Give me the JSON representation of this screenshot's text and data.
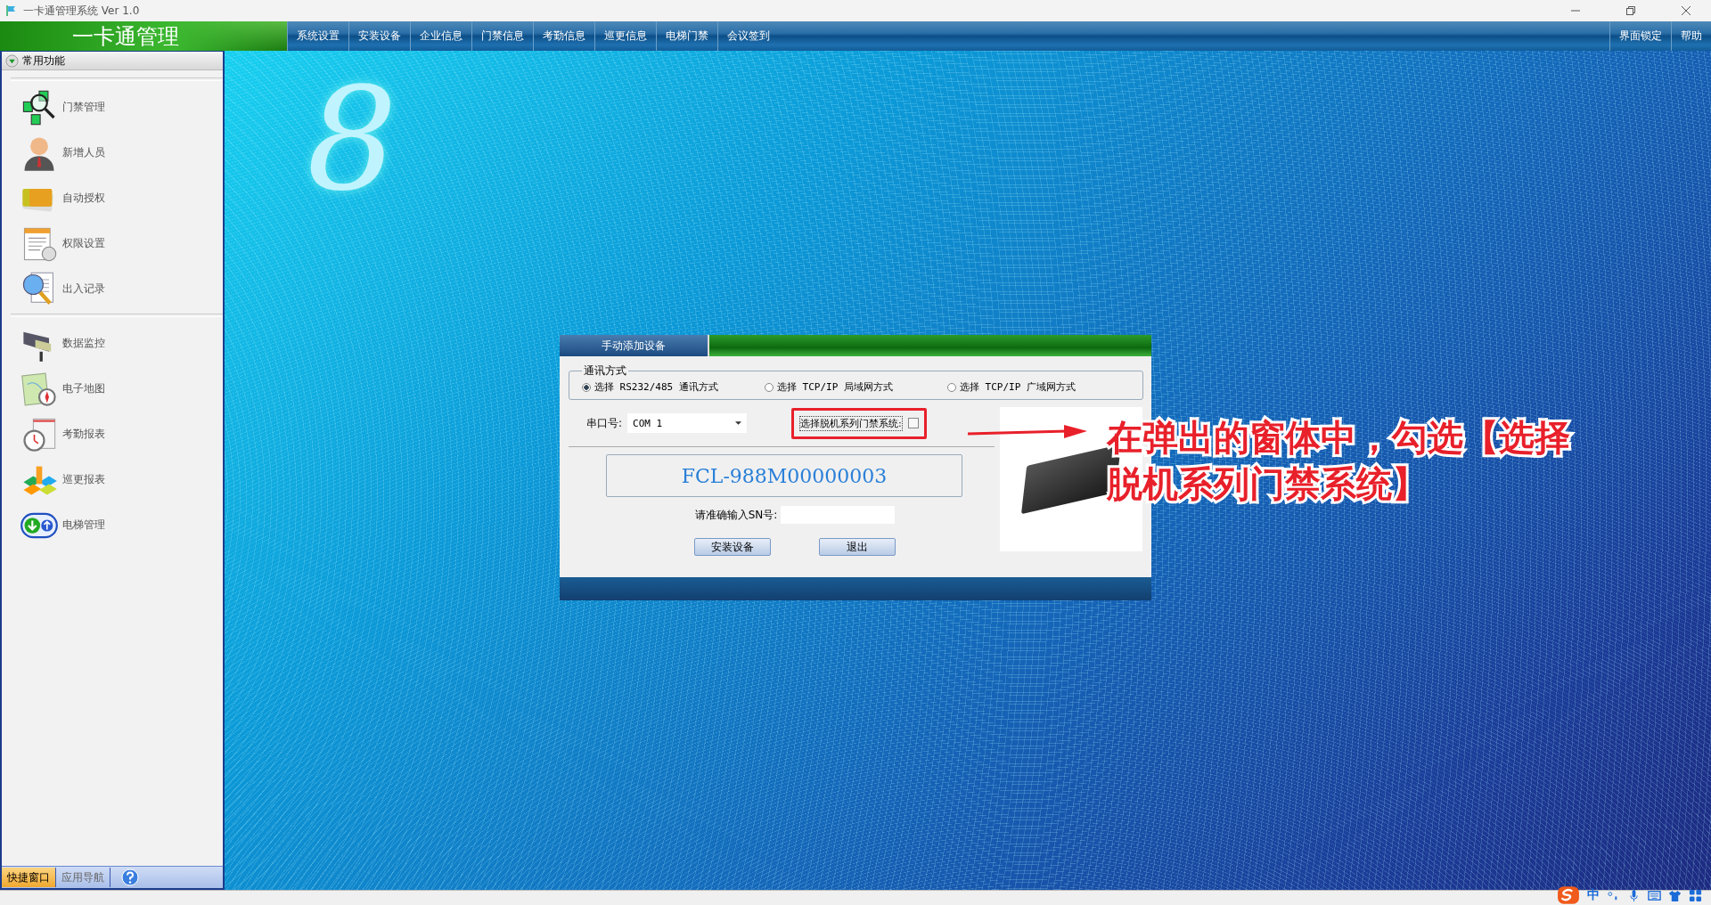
{
  "window": {
    "title": "一卡通管理系统 Ver 1.0"
  },
  "app_title": "一卡通管理",
  "menu": [
    {
      "label": "系统设置"
    },
    {
      "label": "安装设备"
    },
    {
      "label": "企业信息"
    },
    {
      "label": "门禁信息"
    },
    {
      "label": "考勤信息"
    },
    {
      "label": "巡更信息"
    },
    {
      "label": "电梯门禁"
    },
    {
      "label": "会议签到"
    }
  ],
  "menu_right": [
    {
      "label": "界面锁定"
    },
    {
      "label": "帮助"
    }
  ],
  "sidebar": {
    "header": "常用功能",
    "groups": [
      {
        "items": [
          {
            "label": "门禁管理",
            "kind": "chips"
          },
          {
            "label": "新增人员",
            "kind": "person"
          },
          {
            "label": "自动授权",
            "kind": "cards"
          },
          {
            "label": "权限设置",
            "kind": "document"
          },
          {
            "label": "出入记录",
            "kind": "magnifier"
          }
        ]
      },
      {
        "items": [
          {
            "label": "数据监控",
            "kind": "camera"
          },
          {
            "label": "电子地图",
            "kind": "map"
          },
          {
            "label": "考勤报表",
            "kind": "clock"
          },
          {
            "label": "巡更报表",
            "kind": "blocks"
          },
          {
            "label": "电梯管理",
            "kind": "elevator"
          }
        ]
      }
    ]
  },
  "bottom_tabs": [
    {
      "label": "快捷窗口",
      "selected": true
    },
    {
      "label": "应用导航",
      "selected": false
    }
  ],
  "logo": "8",
  "dialog": {
    "title": "手动添加设备",
    "group_label": "通讯方式",
    "modes": [
      {
        "label": "选择 RS232/485 通讯方式",
        "selected": true
      },
      {
        "label": "选择 TCP/IP 局域网方式",
        "selected": false
      },
      {
        "label": "选择 TCP/IP 广域网方式",
        "selected": false
      }
    ],
    "port_label": "串口号:",
    "port_value": "COM 1",
    "offline_label": "选择脱机系列门禁系统:",
    "offline_checked": false,
    "sn_display": "FCL-988M00000003",
    "sn_label": "请准确输入SN号:",
    "buttons": [
      "安装设备",
      "退出"
    ]
  },
  "annotation": {
    "text": "在弹出的窗体中，勾选【选择脱机系列门禁系统】"
  },
  "ime": {
    "label": "中"
  }
}
